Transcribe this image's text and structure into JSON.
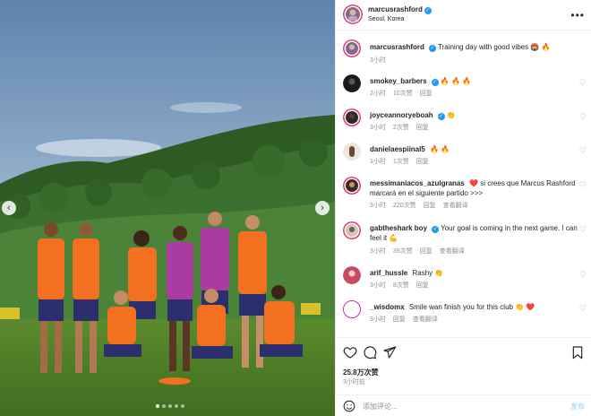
{
  "post": {
    "author": "marcusrashford",
    "location": "Seoul, Korea",
    "caption": "Training day with good vibes 🏟️ 🔥",
    "caption_age": "3小时",
    "likes": "25.8万次赞",
    "posted_ago": "3小时前"
  },
  "comments": [
    {
      "user": "smokey_barbers",
      "verified": true,
      "text": "🔥 🔥 🔥",
      "age": "2小时",
      "likes": "10次赞",
      "reply": "回复",
      "translate": ""
    },
    {
      "user": "joyceannoryeboah",
      "verified": true,
      "text": "👏",
      "age": "3小时",
      "likes": "2次赞",
      "reply": "回复",
      "translate": ""
    },
    {
      "user": "danielaespiinal5",
      "verified": false,
      "text": "🔥 🔥",
      "age": "1小时",
      "likes": "1次赞",
      "reply": "回复",
      "translate": ""
    },
    {
      "user": "messimaniacos_azulgranas",
      "verified": false,
      "text": "❤️ si crees que Marcus Rashford marcará en el siguiente partido >>>",
      "age": "3小时",
      "likes": "220次赞",
      "reply": "回复",
      "translate": "查看翻译"
    },
    {
      "user": "gabtheshark boy",
      "verified": true,
      "text": "Your goal is coming in the next game. I can feel it 💪",
      "age": "3小时",
      "likes": "39次赞",
      "reply": "回复",
      "translate": "查看翻译"
    },
    {
      "user": "arif_hussle",
      "verified": false,
      "text": "Rashy 👏",
      "age": "3小时",
      "likes": "8次赞",
      "reply": "回复",
      "translate": ""
    },
    {
      "user": "_wisdomx",
      "verified": false,
      "text": "Smile wan finish you for this club 👏 ❤️",
      "age": "3小时",
      "likes": "",
      "reply": "回复",
      "translate": "查看翻译"
    }
  ],
  "composer": {
    "placeholder": "添加评论...",
    "post_label": "发布"
  },
  "icons": {
    "more": "more-options-icon",
    "like": "heart-icon",
    "comment": "comment-icon",
    "share": "send-icon",
    "save": "bookmark-icon",
    "emoji": "emoji-icon",
    "prev": "chevron-left-icon",
    "next": "chevron-right-icon"
  },
  "colors": {
    "accent": "#1d9bf0",
    "muted": "#8e8e8e",
    "post_button": "#b2dffc",
    "jersey": "#f37021"
  },
  "carousel": {
    "slides": 5,
    "active_index": 0
  }
}
